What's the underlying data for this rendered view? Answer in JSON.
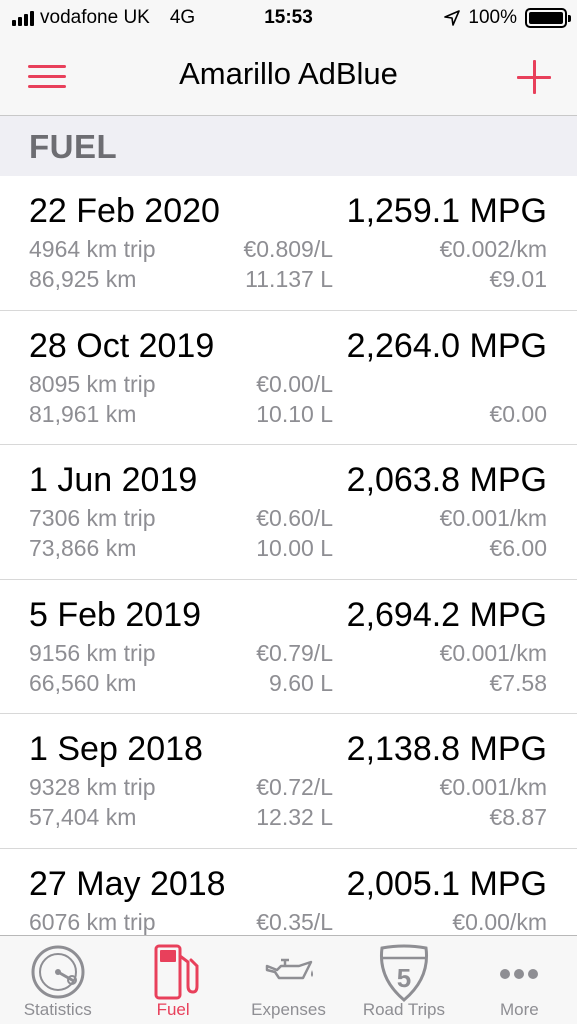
{
  "status_bar": {
    "carrier": "vodafone UK",
    "network": "4G",
    "time": "15:53",
    "battery": "100%",
    "battery_level": 1.0
  },
  "nav": {
    "title": "Amarillo AdBlue",
    "menu_icon": "hamburger-icon",
    "add_icon": "plus-icon",
    "accent_color": "#e8405b"
  },
  "section": {
    "title": "FUEL"
  },
  "entries": [
    {
      "date": "22 Feb 2020",
      "mpg": "1,259.1 MPG",
      "trip": "4964 km trip",
      "price": "€0.809/L",
      "cost_per_km": "€0.002/km",
      "odometer": "86,925 km",
      "volume": "11.137 L",
      "total": "€9.01"
    },
    {
      "date": "28 Oct 2019",
      "mpg": "2,264.0 MPG",
      "trip": "8095 km trip",
      "price": "€0.00/L",
      "cost_per_km": "",
      "odometer": "81,961 km",
      "volume": "10.10 L",
      "total": "€0.00"
    },
    {
      "date": "1 Jun 2019",
      "mpg": "2,063.8 MPG",
      "trip": "7306 km trip",
      "price": "€0.60/L",
      "cost_per_km": "€0.001/km",
      "odometer": "73,866 km",
      "volume": "10.00 L",
      "total": "€6.00"
    },
    {
      "date": "5 Feb 2019",
      "mpg": "2,694.2 MPG",
      "trip": "9156 km trip",
      "price": "€0.79/L",
      "cost_per_km": "€0.001/km",
      "odometer": "66,560 km",
      "volume": "9.60 L",
      "total": "€7.58"
    },
    {
      "date": "1 Sep 2018",
      "mpg": "2,138.8 MPG",
      "trip": "9328 km trip",
      "price": "€0.72/L",
      "cost_per_km": "€0.001/km",
      "odometer": "57,404 km",
      "volume": "12.32 L",
      "total": "€8.87"
    },
    {
      "date": "27 May 2018",
      "mpg": "2,005.1 MPG",
      "trip": "6076 km trip",
      "price": "€0.35/L",
      "cost_per_km": "€0.00/km",
      "odometer": "",
      "volume": "",
      "total": ""
    }
  ],
  "tabs": [
    {
      "label": "Statistics",
      "icon": "gauge-icon",
      "active": false
    },
    {
      "label": "Fuel",
      "icon": "fuel-pump-icon",
      "active": true
    },
    {
      "label": "Expenses",
      "icon": "oil-can-icon",
      "active": false
    },
    {
      "label": "Road Trips",
      "icon": "highway-shield-icon",
      "active": false,
      "badge": "5"
    },
    {
      "label": "More",
      "icon": "more-dots-icon",
      "active": false
    }
  ]
}
